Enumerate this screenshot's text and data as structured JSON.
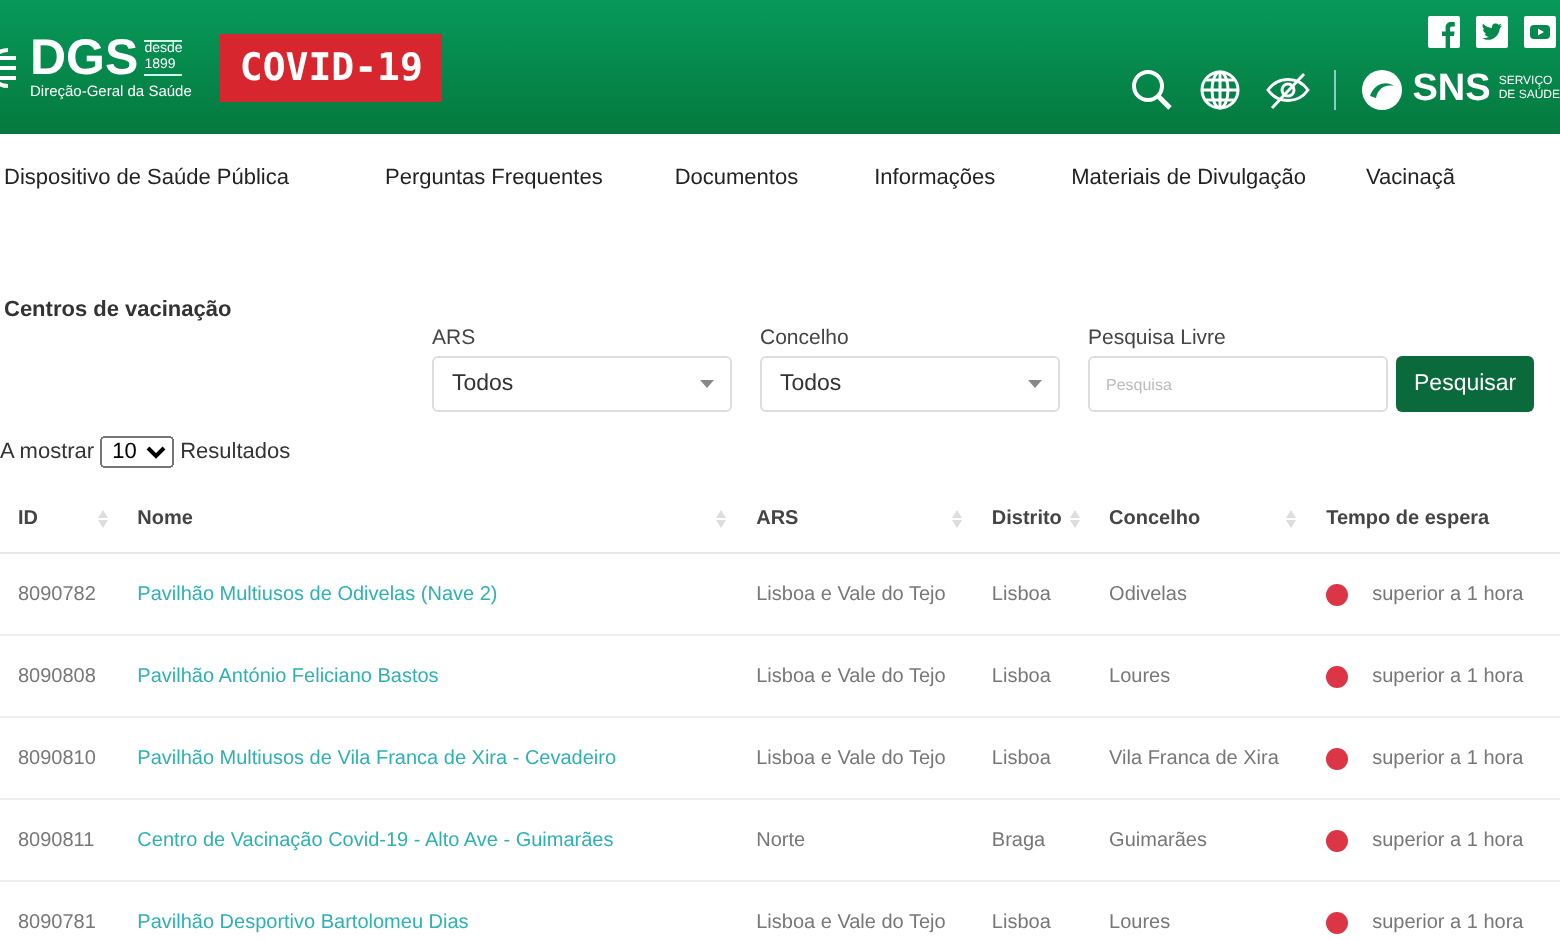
{
  "header": {
    "logo_text": "DGS",
    "logo_since": "desde",
    "logo_year": "1899",
    "logo_subtitle": "Direção-Geral da Saúde",
    "badge": "COVID-19",
    "sns_text": "SNS",
    "sns_sub_1": "SERVIÇO",
    "sns_sub_2": "DE SAÚDE"
  },
  "nav": [
    {
      "label": "Dispositivo de Saúde Pública"
    },
    {
      "label": "Perguntas Frequentes"
    },
    {
      "label": "Documentos"
    },
    {
      "label": "Informações"
    },
    {
      "label": "Materiais de Divulgação"
    },
    {
      "label": "Vacinaçã"
    }
  ],
  "title": "Centros de vacinação",
  "filters": [
    {
      "kind": "select",
      "label": "ARS",
      "value": "Todos"
    },
    {
      "kind": "select",
      "label": "Concelho",
      "value": "Todos"
    },
    {
      "kind": "text",
      "label": "Pesquisa Livre",
      "placeholder": "Pesquisa"
    }
  ],
  "search_button": "Pesquisar",
  "page_size": {
    "before": "A mostrar",
    "value": "10",
    "after": "Resultados"
  },
  "table": {
    "columns": [
      "ID",
      "Nome",
      "ARS",
      "Distrito",
      "Concelho",
      "Tempo de espera"
    ],
    "rows": [
      {
        "id": "8090782",
        "name": "Pavilhão Multiusos de Odivelas (Nave 2)",
        "ars": "Lisboa e Vale do Tejo",
        "district": "Lisboa",
        "municipality": "Odivelas",
        "wait": "superior a 1 hora",
        "color": "#dc3545"
      },
      {
        "id": "8090808",
        "name": "Pavilhão António Feliciano Bastos",
        "ars": "Lisboa e Vale do Tejo",
        "district": "Lisboa",
        "municipality": "Loures",
        "wait": "superior a 1 hora",
        "color": "#dc3545"
      },
      {
        "id": "8090810",
        "name": "Pavilhão Multiusos de Vila Franca de Xira - Cevadeiro",
        "ars": "Lisboa e Vale do Tejo",
        "district": "Lisboa",
        "municipality": "Vila Franca de Xira",
        "wait": "superior a 1 hora",
        "color": "#dc3545"
      },
      {
        "id": "8090811",
        "name": "Centro de Vacinação Covid-19 - Alto Ave - Guimarães",
        "ars": "Norte",
        "district": "Braga",
        "municipality": "Guimarães",
        "wait": "superior a 1 hora",
        "color": "#dc3545"
      },
      {
        "id": "8090781",
        "name": "Pavilhão Desportivo Bartolomeu Dias",
        "ars": "Lisboa e Vale do Tejo",
        "district": "Lisboa",
        "municipality": "Loures",
        "wait": "superior a 1 hora",
        "color": "#dc3545"
      }
    ]
  }
}
